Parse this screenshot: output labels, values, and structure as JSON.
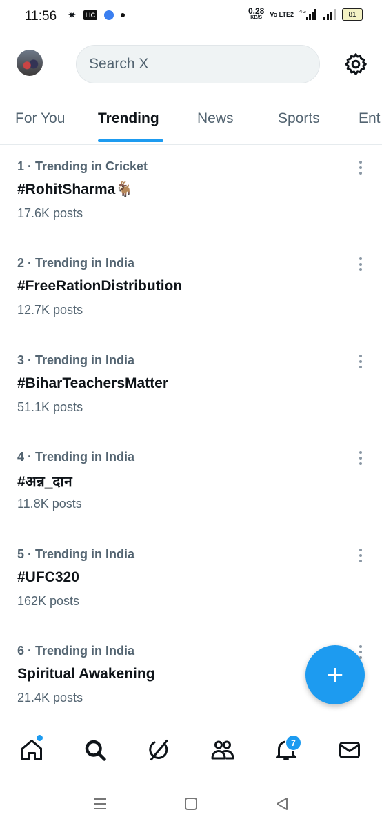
{
  "status_bar": {
    "time": "11:56",
    "lic": "LIC",
    "speed_value": "0.28",
    "speed_unit": "KB/S",
    "volte": "Vo LTE2",
    "network": "4G",
    "battery": "81"
  },
  "header": {
    "search_placeholder": "Search X",
    "avatar_icon": "avatar",
    "settings_icon": "gear-icon"
  },
  "tabs": [
    {
      "label": "For You"
    },
    {
      "label": "Trending",
      "active": true
    },
    {
      "label": "News"
    },
    {
      "label": "Sports"
    },
    {
      "label": "Ent"
    }
  ],
  "trends": [
    {
      "meta": "1 · Trending in Cricket",
      "name": "#RohitSharma",
      "emoji": "🐐",
      "posts": "17.6K posts"
    },
    {
      "meta": "2 · Trending in India",
      "name": "#FreeRationDistribution",
      "posts": "12.7K posts"
    },
    {
      "meta": "3 · Trending in India",
      "name": "#BiharTeachersMatter",
      "posts": "51.1K posts"
    },
    {
      "meta": "4 · Trending in India",
      "name": "#अन्न_दान",
      "posts": "11.8K posts"
    },
    {
      "meta": "5 · Trending in India",
      "name": "#UFC320",
      "posts": "162K posts"
    },
    {
      "meta": "6 · Trending in India",
      "name": "Spiritual Awakening",
      "posts": "21.4K posts"
    }
  ],
  "fab": {
    "label": "+"
  },
  "bottom_nav": {
    "items": [
      "home-icon",
      "search-icon",
      "grok-icon",
      "communities-icon",
      "notifications-icon",
      "messages-icon"
    ],
    "notification_count": "7"
  },
  "colors": {
    "accent": "#1d9bf0",
    "secondary_text": "#536471",
    "primary_text": "#0f1419"
  }
}
